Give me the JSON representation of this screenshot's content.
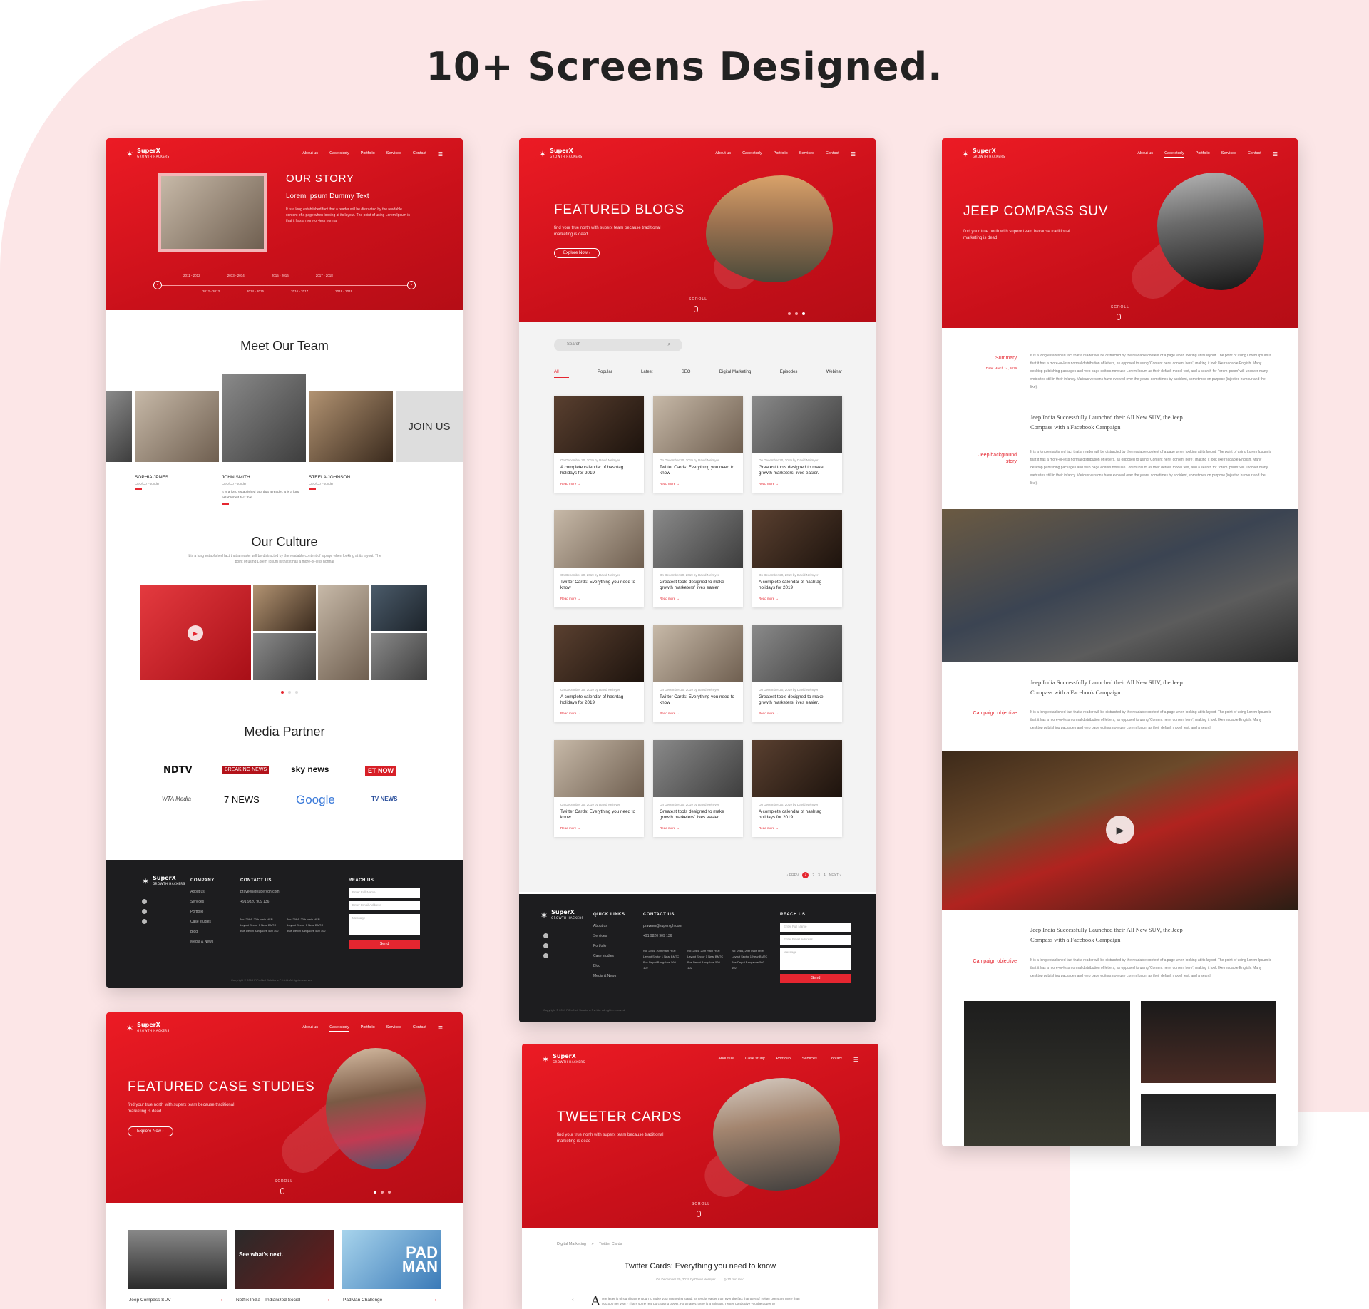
{
  "headline": "10+  Screens Designed.",
  "brand": {
    "name": "SuperX",
    "tagline": "GROWTH HACKERS"
  },
  "nav": {
    "about": "About us",
    "case": "Case study",
    "portfolio": "Portfolio",
    "services": "Services",
    "contact": "Contact"
  },
  "story": {
    "title": "OUR STORY",
    "subtitle": "Lorem Ipsum Dummy Text",
    "body": "It is a long established fact that a reader will be distracted by the readable content of a page when looking at its layout. The point of using Lorem Ipsum is that it has a more-or-less normal",
    "years_top": [
      "2011 - 2012",
      "2013 - 2014",
      "2015 - 2016",
      "2017 - 2018"
    ],
    "years_bottom": [
      "2012 - 2013",
      "2014 - 2015",
      "2016 - 2017",
      "2018 - 2019"
    ],
    "team_title": "Meet Our Team",
    "join": "JOIN US",
    "team": [
      {
        "name": "SOPHIA JPNES",
        "role": "CEO/Co Founder"
      },
      {
        "name": "JOHN SMITH",
        "role": "CEO/Co Founder",
        "desc": "It is a long established fact that a reader. It is a long established fact that"
      },
      {
        "name": "STEELA JOHNSON",
        "role": "CEO/Co Founder"
      }
    ],
    "culture_title": "Our Culture",
    "culture_body": "It is a long established fact that a reader will be distracted by the readable content of a page when looking at its layout. The point of using Lorem Ipsum is that it has a more-or-less normal",
    "media_title": "Media Partner",
    "media": [
      "NDTV",
      "BREAKING NEWS",
      "sky news",
      "ET NOW",
      "WTA Media",
      "7 NEWS",
      "Google",
      "TV NEWS"
    ]
  },
  "footer": {
    "company": "COMPANY",
    "quick": "QUICK LINKS",
    "contact": "CONTACT US",
    "reach": "REACH US",
    "links": [
      "About us",
      "Services",
      "Portfolio",
      "Case studies",
      "Blog",
      "Media & News"
    ],
    "email": "praveen@superxgh.com",
    "phone": "+91 9820 909 136",
    "addr1": "No: 2984, 20th main HSR Layout Sector 1 Near BMTC Bus Depot Bangalore 560 102",
    "addr2": "No: 2984, 20th main HSR Layout Sector 1 Near BMTC Bus Depot Bangalore 560 102",
    "name_ph": "Enter Full Name",
    "email_ph": "Enter Email Address",
    "msg_ph": "Message",
    "send": "Send",
    "copyright": "Copyright © 2019 PiPo-Neil Solutions Pvt Ltd. All rights reserved"
  },
  "blogs": {
    "title": "FEATURED BLOGS",
    "sub": "find your true north with superx team because traditional marketing is dead",
    "cta": "Explore Now  ›",
    "scroll": "SCROLL",
    "search_ph": "Search",
    "tabs": [
      "All",
      "Popular",
      "Latest",
      "SEO",
      "Digital Marketing",
      "Episodes",
      "Webinar"
    ],
    "meta": "On December 20, 2019 by David Nelmyer",
    "read": "Read more  →",
    "cards": [
      "A complete calendar of hashtag holidays for 2019",
      "Twitter Cards: Everything you need to know",
      "Greatest tools designed to make growth marketers' lives easier.",
      "Twitter Cards: Everything you need to know",
      "Greatest tools designed to make growth marketers' lives easier.",
      "A complete calendar of hashtag holidays for 2019",
      "A complete calendar of hashtag holidays for 2019",
      "Twitter Cards: Everything you need to know",
      "Greatest tools designed to make growth marketers' lives easier.",
      "Twitter Cards: Everything you need to know",
      "Greatest tools designed to make growth marketers' lives easier.",
      "A complete calendar of hashtag holidays for 2019"
    ],
    "prev": "‹ PREV",
    "pages": [
      "1",
      "2",
      "3",
      "4"
    ],
    "next": "NEXT ›"
  },
  "jeep": {
    "title": "JEEP COMPASS SUV",
    "sub": "find your true north with superx team because traditional marketing is dead",
    "scroll": "SCROLL",
    "summary": "Summary",
    "date": "Date: March 14, 2019",
    "para": "It is a long established fact that a reader will be distracted by the readable content of a page when looking at its layout. The point of using Lorem Ipsum is that it has a more-or-less normal distribution of letters, as opposed to using 'Content here, content here', making it look like readable English. Many desktop publishing packages and web page editors now use Lorem Ipsum as their default model text, and a search for 'lorem ipsum' will uncover many web sites still in their infancy. Various versions have evolved over the years, sometimes by accident, sometimes on purpose (injected humour and the like).",
    "quote": "Jeep India Successfully Launched their All New SUV, the Jeep Compass with a Facebook Campaign",
    "bg": "Jeep background story",
    "obj": "Campaign objective",
    "para_short": "It is a long established fact that a reader will be distracted by the readable content of a page when looking at its layout. The point of using Lorem Ipsum is that it has a more-or-less normal distribution of letters, as opposed to using 'Content here, content here', making it look like readable English. Many desktop publishing packages and web page editors now use Lorem Ipsum as their default model text, and a search"
  },
  "cases": {
    "title": "FEATURED CASE STUDIES",
    "sub": "find your true north with superx team because traditional marketing is dead",
    "cta": "Explore Now  ›",
    "scroll": "SCROLL",
    "items": [
      "Jeep Compass SUV",
      "Netflix India – Indianized Social",
      "PadMan Challenge"
    ],
    "netflix_text": "See what's next.",
    "padman_text": "PAD MAN"
  },
  "tweeter": {
    "title": "TWEETER CARDS",
    "sub": "find your true north with superx team because traditional marketing is dead",
    "scroll": "SCROLL",
    "crumb1": "Digital Marketing",
    "crumb2": "Twitter Cards",
    "heading": "Twitter Cards: Everything you need to know",
    "meta": "On December 20, 2019 by David Nelmyer",
    "read": "10 min read",
    "body": "one letter is of significant enough to make your marketing stand. Its results easier than ever the fact that 55% of Twitter users are more than 500,000 per year? That's some real purchasing power. Fortunately, there is a solution: Twitter Cards give you the power to"
  }
}
